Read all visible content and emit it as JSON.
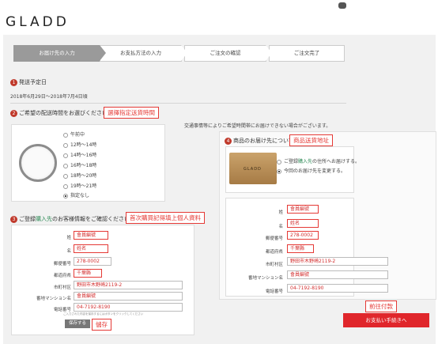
{
  "brand": {
    "logo": "GLADD"
  },
  "steps": [
    {
      "label": "お届け先の入力",
      "active": true
    },
    {
      "label": "お支払方法の入力",
      "active": false
    },
    {
      "label": "ご注文の確認",
      "active": false
    },
    {
      "label": "ご注文完了",
      "active": false
    }
  ],
  "section1": {
    "num": "1",
    "title": "発送予定日",
    "date": "2018年6月29日〜2018年7月4日頃"
  },
  "section2": {
    "num": "2",
    "title": "ご希望の配送時間をお選びください",
    "annotation": "選擇指定送貨時間",
    "notice": "交通事情等によりご希望時間帯にお届けできない場合がございます。",
    "options": [
      {
        "label": "午前中",
        "selected": false
      },
      {
        "label": "12時〜14時",
        "selected": false
      },
      {
        "label": "14時〜16時",
        "selected": false
      },
      {
        "label": "16時〜18時",
        "selected": false
      },
      {
        "label": "18時〜20時",
        "selected": false
      },
      {
        "label": "19時〜21時",
        "selected": false
      },
      {
        "label": "指定なし",
        "selected": true
      }
    ]
  },
  "section3": {
    "num": "3",
    "title_pre": "ご登録",
    "title_green": "購入先",
    "title_post": "のお客様情報をご確認ください",
    "annotation": "首次購買記得填上個人資料",
    "fields": [
      {
        "label": "姓",
        "value": "會員編號"
      },
      {
        "label": "名",
        "value": "姓名"
      },
      {
        "label": "郵便番号",
        "value": "278-0002"
      },
      {
        "label": "都道府県",
        "value": "千葉縣"
      },
      {
        "label": "市町村区",
        "value": "野田市木野崎2119-2"
      },
      {
        "label": "番地マンション名",
        "value": "會員編號"
      },
      {
        "label": "電話番号",
        "value": "04-7192-8190"
      }
    ],
    "save_button": "保存する",
    "save_annotation": "儲存",
    "note": "ご入力された内容を保存するにはボタンをクリックしてください"
  },
  "section4": {
    "num": "4",
    "title": "商品のお届け先について",
    "annotation": "商品送貨地址",
    "box_label": "GLADD",
    "options": [
      {
        "pre": "ご登録",
        "green": "購入先",
        "post": "の住所へお届けする。",
        "selected": false
      },
      {
        "pre": "",
        "green": "",
        "post": "今回のお届け先を変更する。",
        "selected": true
      }
    ],
    "fields": [
      {
        "label": "姓",
        "value": "會員編號"
      },
      {
        "label": "名",
        "value": "姓名"
      },
      {
        "label": "郵便番号",
        "value": "278-0002"
      },
      {
        "label": "都道府県",
        "value": "千葉縣"
      },
      {
        "label": "市町村区",
        "value": "野田市木野崎2119-2"
      },
      {
        "label": "番地マンション名",
        "value": "會員編號"
      },
      {
        "label": "電話番号",
        "value": "04-7192-8190"
      }
    ]
  },
  "checkout": {
    "annotation": "前往付款",
    "button": "お支払い手続きへ"
  }
}
